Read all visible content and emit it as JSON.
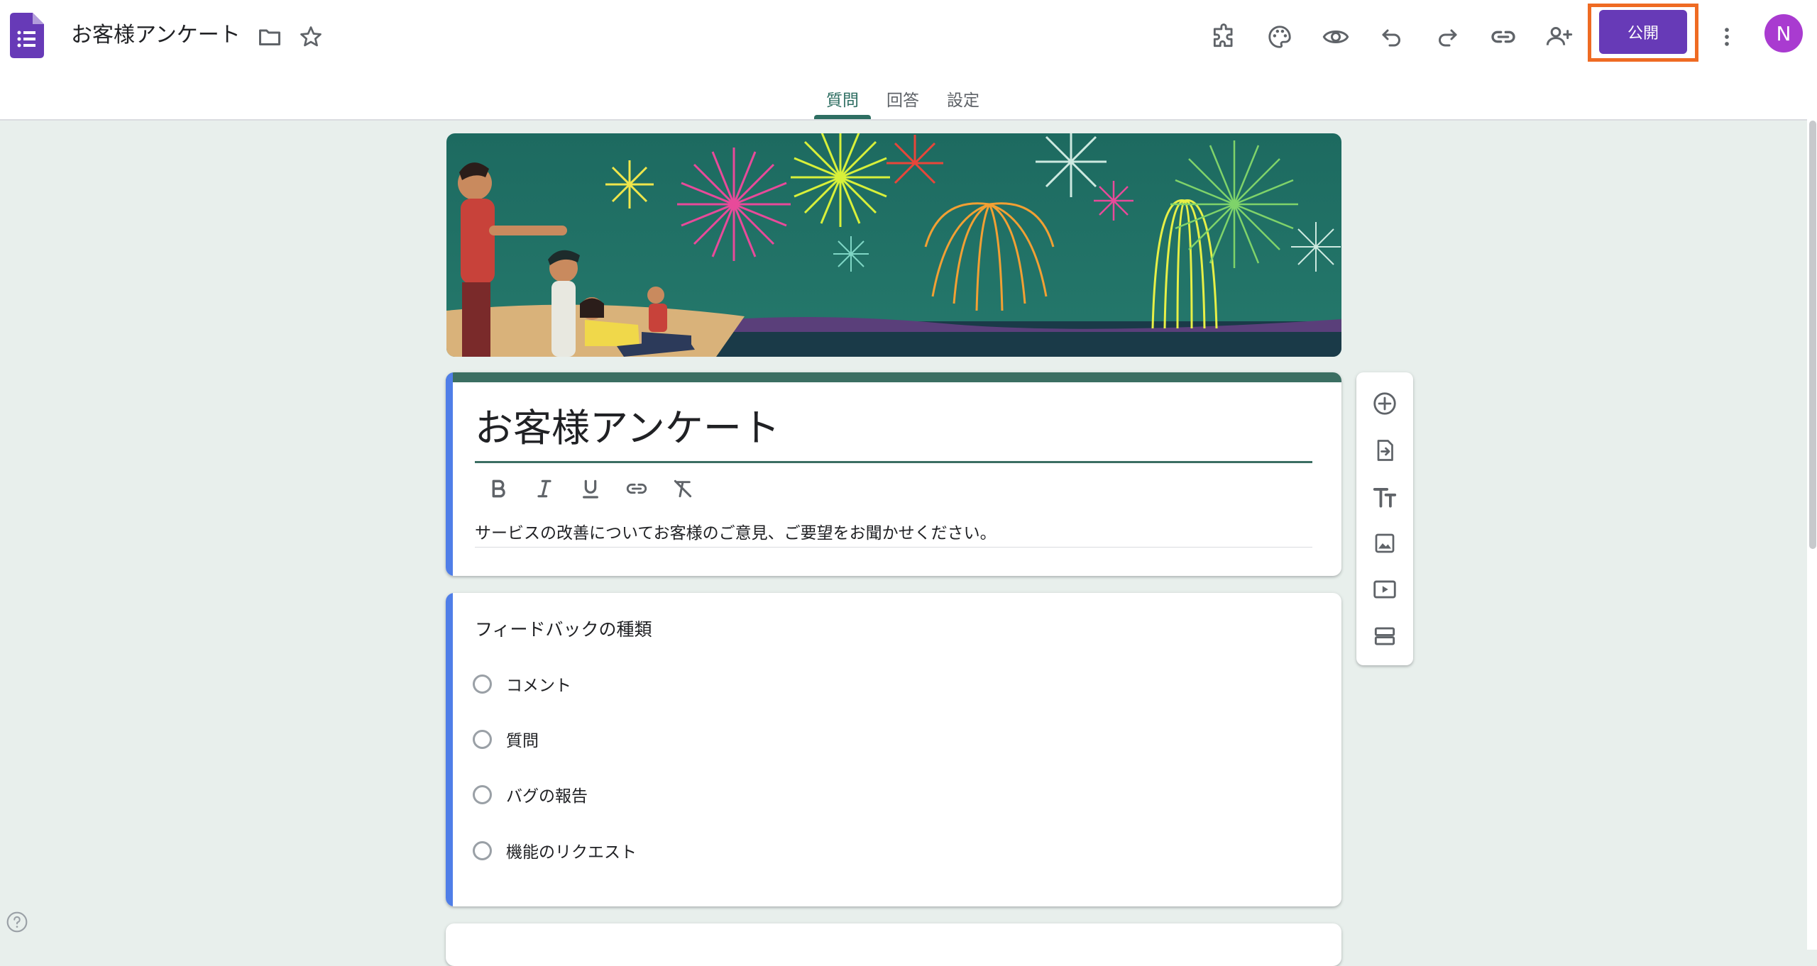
{
  "header": {
    "doc_title": "お客様アンケート",
    "publish_label": "公開",
    "avatar_initial": "N",
    "toolbar_icons": [
      "addon-icon",
      "palette-icon",
      "preview-icon",
      "undo-icon",
      "redo-icon",
      "link-icon",
      "add-collaborator-icon",
      "more-vert-icon"
    ]
  },
  "tabs": [
    {
      "label": "質問",
      "active": true
    },
    {
      "label": "回答",
      "active": false
    },
    {
      "label": "設定",
      "active": false
    }
  ],
  "form": {
    "title": "お客様アンケート",
    "description": "サービスの改善についてお客様のご意見、ご要望をお聞かせください。",
    "format_tools": [
      "bold-icon",
      "italic-icon",
      "underline-icon",
      "link-icon",
      "clear-format-icon"
    ]
  },
  "question": {
    "title": "フィードバックの種類",
    "options": [
      "コメント",
      "質問",
      "バグの報告",
      "機能のリクエスト"
    ]
  },
  "side_toolbar": [
    "add-question-icon",
    "import-questions-icon",
    "add-title-icon",
    "add-image-icon",
    "add-video-icon",
    "add-section-icon"
  ],
  "colors": {
    "accent": "#673ab7",
    "theme": "#3b6e62",
    "highlight": "#ef6b23",
    "left_accent": "#4f7ee8",
    "background": "#e8efec"
  }
}
